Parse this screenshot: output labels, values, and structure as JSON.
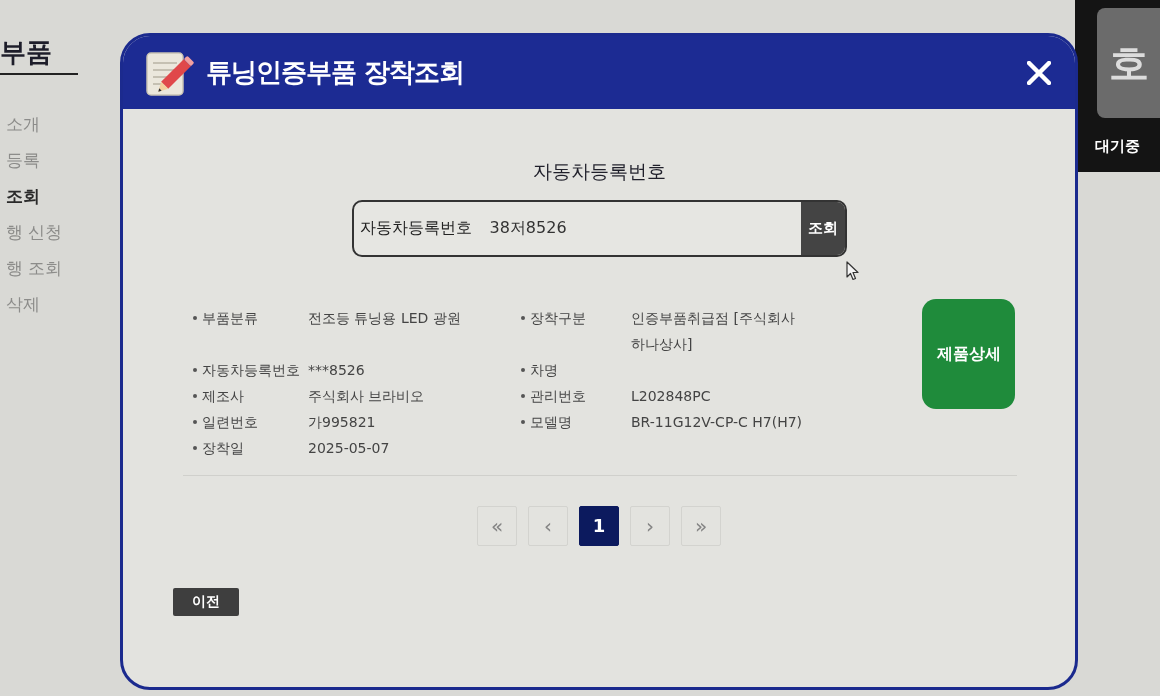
{
  "sidebar": {
    "title": "부품",
    "items": [
      {
        "label": "소개",
        "selected": false
      },
      {
        "label": "등록",
        "selected": false
      },
      {
        "label": "조회",
        "selected": true
      },
      {
        "label": "행 신청",
        "selected": false
      },
      {
        "label": "행 조회",
        "selected": false
      },
      {
        "label": "삭제",
        "selected": false
      }
    ]
  },
  "queue_panel": {
    "tile": "호",
    "status": "대기중"
  },
  "dialog": {
    "title": "튜닝인증부품 장착조회",
    "search": {
      "heading": "자동차등록번호",
      "label": "자동차등록번호",
      "value": "38저8526",
      "button": "조회"
    },
    "details": [
      {
        "cells": [
          {
            "label": "부품분류",
            "value": "전조등 튜닝용 LED 광원"
          },
          {
            "label": "장착구분",
            "value": "인증부품취급점 [주식회사 하나상사]"
          }
        ]
      },
      {
        "cells": [
          {
            "label": "자동차등록번호",
            "value": "***8526"
          },
          {
            "label": "차명"
          }
        ]
      },
      {
        "cells": [
          {
            "label": "제조사",
            "value": "주식회사 브라비오"
          },
          {
            "label": "관리번호",
            "value": "L202848PC"
          }
        ]
      },
      {
        "cells": [
          {
            "label": "일련번호",
            "value": "가995821"
          },
          {
            "label": "모델명",
            "value": "BR-11G12V-CP-C H7(H7)"
          }
        ]
      },
      {
        "cells": [
          {
            "label": "장착일",
            "value": "2025-05-07"
          }
        ]
      }
    ],
    "detail_button": "제품상세",
    "pagination": [
      {
        "kind": "first",
        "label": "«",
        "selected": false
      },
      {
        "kind": "prev",
        "label": "‹",
        "selected": false
      },
      {
        "kind": "page",
        "label": "1",
        "selected": true
      },
      {
        "kind": "next",
        "label": "›",
        "selected": false
      },
      {
        "kind": "last",
        "label": "»",
        "selected": false
      }
    ],
    "back_button": "이전"
  }
}
